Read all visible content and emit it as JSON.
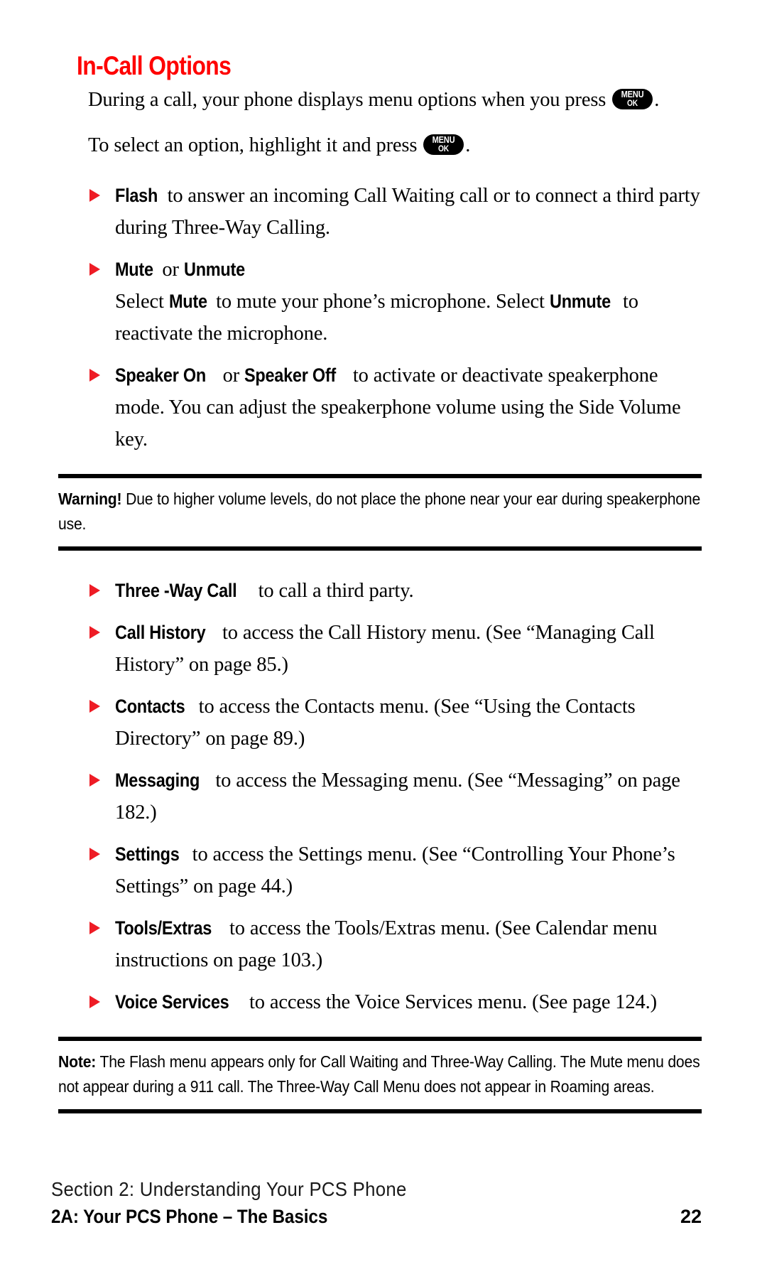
{
  "document": {
    "title": "In-Call Options",
    "title_color": "#ff0000",
    "bullet_color": "#ee1c25"
  },
  "intro": {
    "para1_before": "During a call, your phone displays menu options when you press ",
    "para1_after": ".",
    "para2_before": "To select an option, highlight it and press ",
    "para2_after": "."
  },
  "menu_key": {
    "line1": "MENU",
    "line2": "OK",
    "icon_name": "menu-ok-key-icon"
  },
  "bullets_top": [
    {
      "term": "Flash",
      "text": " to answer an incoming Call Waiting call or to connect a third party during Three-Way Calling."
    },
    {
      "term": "Mute",
      "mid": " or ",
      "term2": "Unmute",
      "text": "",
      "sub_before": "Select ",
      "sub_term1": "Mute",
      "sub_mid": " to mute your phone’s microphone. Select ",
      "sub_term2": "Unmute",
      "sub_after": " to reactivate the microphone."
    },
    {
      "term": "Speaker On",
      "mid": " or ",
      "term2": "Speaker Off",
      "text": " to activate or deactivate speakerphone mode. You can adjust the speakerphone volume using the Side Volume key."
    }
  ],
  "warning": {
    "label": "Warning!",
    "text": " Due to higher volume levels, do not place the phone near your ear during speakerphone use."
  },
  "bullets_bottom": [
    {
      "term": "Three -Way Call",
      "text": " to call a third party."
    },
    {
      "term": "Call History",
      "text": " to access the Call History menu. (See “Managing Call History” on page 85.)"
    },
    {
      "term": "Contacts",
      "text": " to access the Contacts menu. (See “Using the Contacts Directory” on page 89.)"
    },
    {
      "term": "Messaging",
      "text": " to access the Messaging menu. (See “Messaging” on page 182.)"
    },
    {
      "term": "Settings",
      "text": " to access the Settings menu. (See “Controlling Your Phone’s Settings” on page 44.)"
    },
    {
      "term": "Tools/Extras",
      "text": " to access the Tools/Extras menu. (See Calendar menu instructions on page 103.)"
    },
    {
      "term": "Voice Services",
      "text": " to access the Voice Services menu. (See page 124.)"
    }
  ],
  "note": {
    "label": "Note:",
    "text": " The Flash menu appears only for Call Waiting and Three-Way Calling. The Mute menu does not appear during a 911 call. The Three-Way Call Menu does not appear in Roaming areas."
  },
  "footer": {
    "section": "Section 2: Understanding Your PCS Phone",
    "chapter": "2A: Your PCS Phone – The Basics",
    "page_number": "22"
  }
}
